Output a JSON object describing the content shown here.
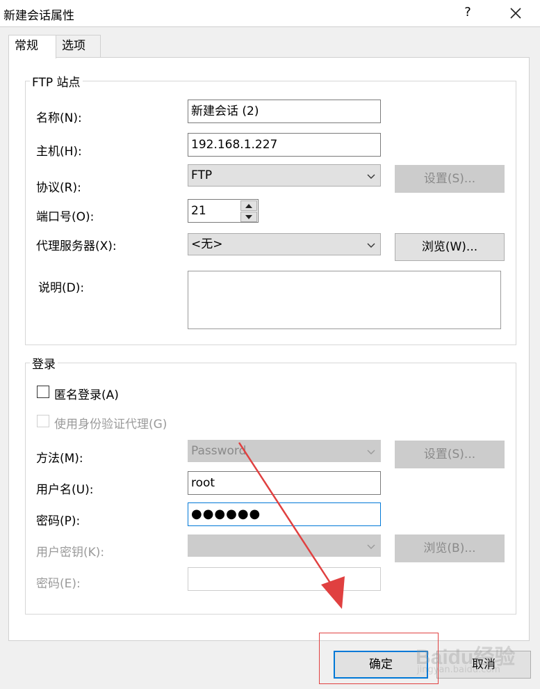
{
  "window": {
    "title": "新建会话属性",
    "help_label": "?",
    "close_icon": "close-icon"
  },
  "tabs": [
    {
      "label": "常规"
    },
    {
      "label": "选项"
    }
  ],
  "ftp_site": {
    "group_title": "FTP 站点",
    "name_label": "名称(N):",
    "name_value": "新建会话 (2)",
    "host_label": "主机(H):",
    "host_value": "192.168.1.227",
    "protocol_label": "协议(R):",
    "protocol_value": "FTP",
    "protocol_settings_button": "设置(S)...",
    "port_label": "端口号(O):",
    "port_value": "21",
    "proxy_label": "代理服务器(X):",
    "proxy_value": "<无>",
    "proxy_browse_button": "浏览(W)...",
    "description_label": "说明(D):",
    "description_value": ""
  },
  "login": {
    "group_title": "登录",
    "anonymous_label": "匿名登录(A)",
    "auth_agent_label": "使用身份验证代理(G)",
    "method_label": "方法(M):",
    "method_value": "Password",
    "method_settings_button": "设置(S)...",
    "username_label": "用户名(U):",
    "username_value": "root",
    "password_label": "密码(P):",
    "password_value": "●●●●●●",
    "user_key_label": "用户密钥(K):",
    "user_key_value": "",
    "key_browse_button": "浏览(B)...",
    "passphrase_label": "密码(E):",
    "passphrase_value": ""
  },
  "footer": {
    "ok_button": "确定",
    "cancel_button": "取消"
  },
  "watermark": {
    "text": "Baidu经验",
    "sub": "jingyan.baidu.com"
  },
  "colors": {
    "accent": "#0078d7",
    "annotation": "#e04040"
  }
}
